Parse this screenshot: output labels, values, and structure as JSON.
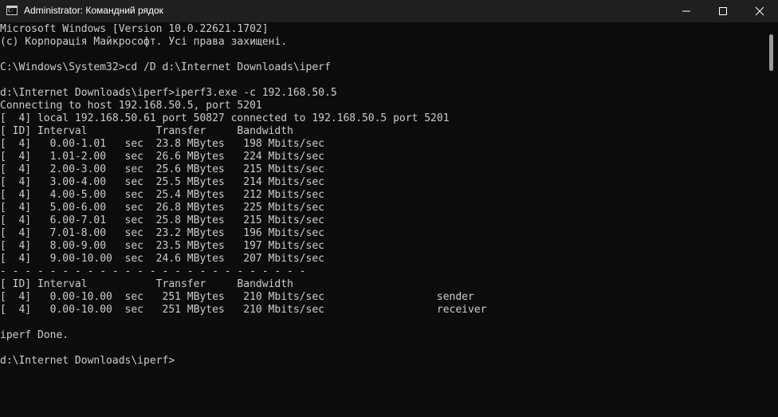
{
  "window": {
    "title": "Administrator: Командний рядок",
    "icon": "cmd-icon",
    "controls": {
      "minimize_icon": "minimize-icon",
      "maximize_icon": "maximize-icon",
      "close_icon": "close-icon"
    }
  },
  "terminal": {
    "lines": [
      "Microsoft Windows [Version 10.0.22621.1702]",
      "(c) Корпорація Майкрософт. Усі права захищені.",
      "",
      "C:\\Windows\\System32>cd /D d:\\Internet Downloads\\iperf",
      "",
      "d:\\Internet Downloads\\iperf>iperf3.exe -c 192.168.50.5",
      "Connecting to host 192.168.50.5, port 5201",
      "[  4] local 192.168.50.61 port 50827 connected to 192.168.50.5 port 5201",
      "[ ID] Interval           Transfer     Bandwidth",
      "[  4]   0.00-1.01   sec  23.8 MBytes   198 Mbits/sec",
      "[  4]   1.01-2.00   sec  26.6 MBytes   224 Mbits/sec",
      "[  4]   2.00-3.00   sec  25.6 MBytes   215 Mbits/sec",
      "[  4]   3.00-4.00   sec  25.5 MBytes   214 Mbits/sec",
      "[  4]   4.00-5.00   sec  25.4 MBytes   212 Mbits/sec",
      "[  4]   5.00-6.00   sec  26.8 MBytes   225 Mbits/sec",
      "[  4]   6.00-7.01   sec  25.8 MBytes   215 Mbits/sec",
      "[  4]   7.01-8.00   sec  23.2 MBytes   196 Mbits/sec",
      "[  4]   8.00-9.00   sec  23.5 MBytes   197 Mbits/sec",
      "[  4]   9.00-10.00  sec  24.6 MBytes   207 Mbits/sec",
      "- - - - - - - - - - - - - - - - - - - - - - - - -",
      "[ ID] Interval           Transfer     Bandwidth",
      "[  4]   0.00-10.00  sec   251 MBytes   210 Mbits/sec                  sender",
      "[  4]   0.00-10.00  sec   251 MBytes   210 Mbits/sec                  receiver",
      "",
      "iperf Done.",
      "",
      "d:\\Internet Downloads\\iperf>"
    ]
  },
  "colors": {
    "terminal_background": "#0c0c0c",
    "titlebar_background": "#1f1f1f",
    "text": "#cccccc"
  }
}
